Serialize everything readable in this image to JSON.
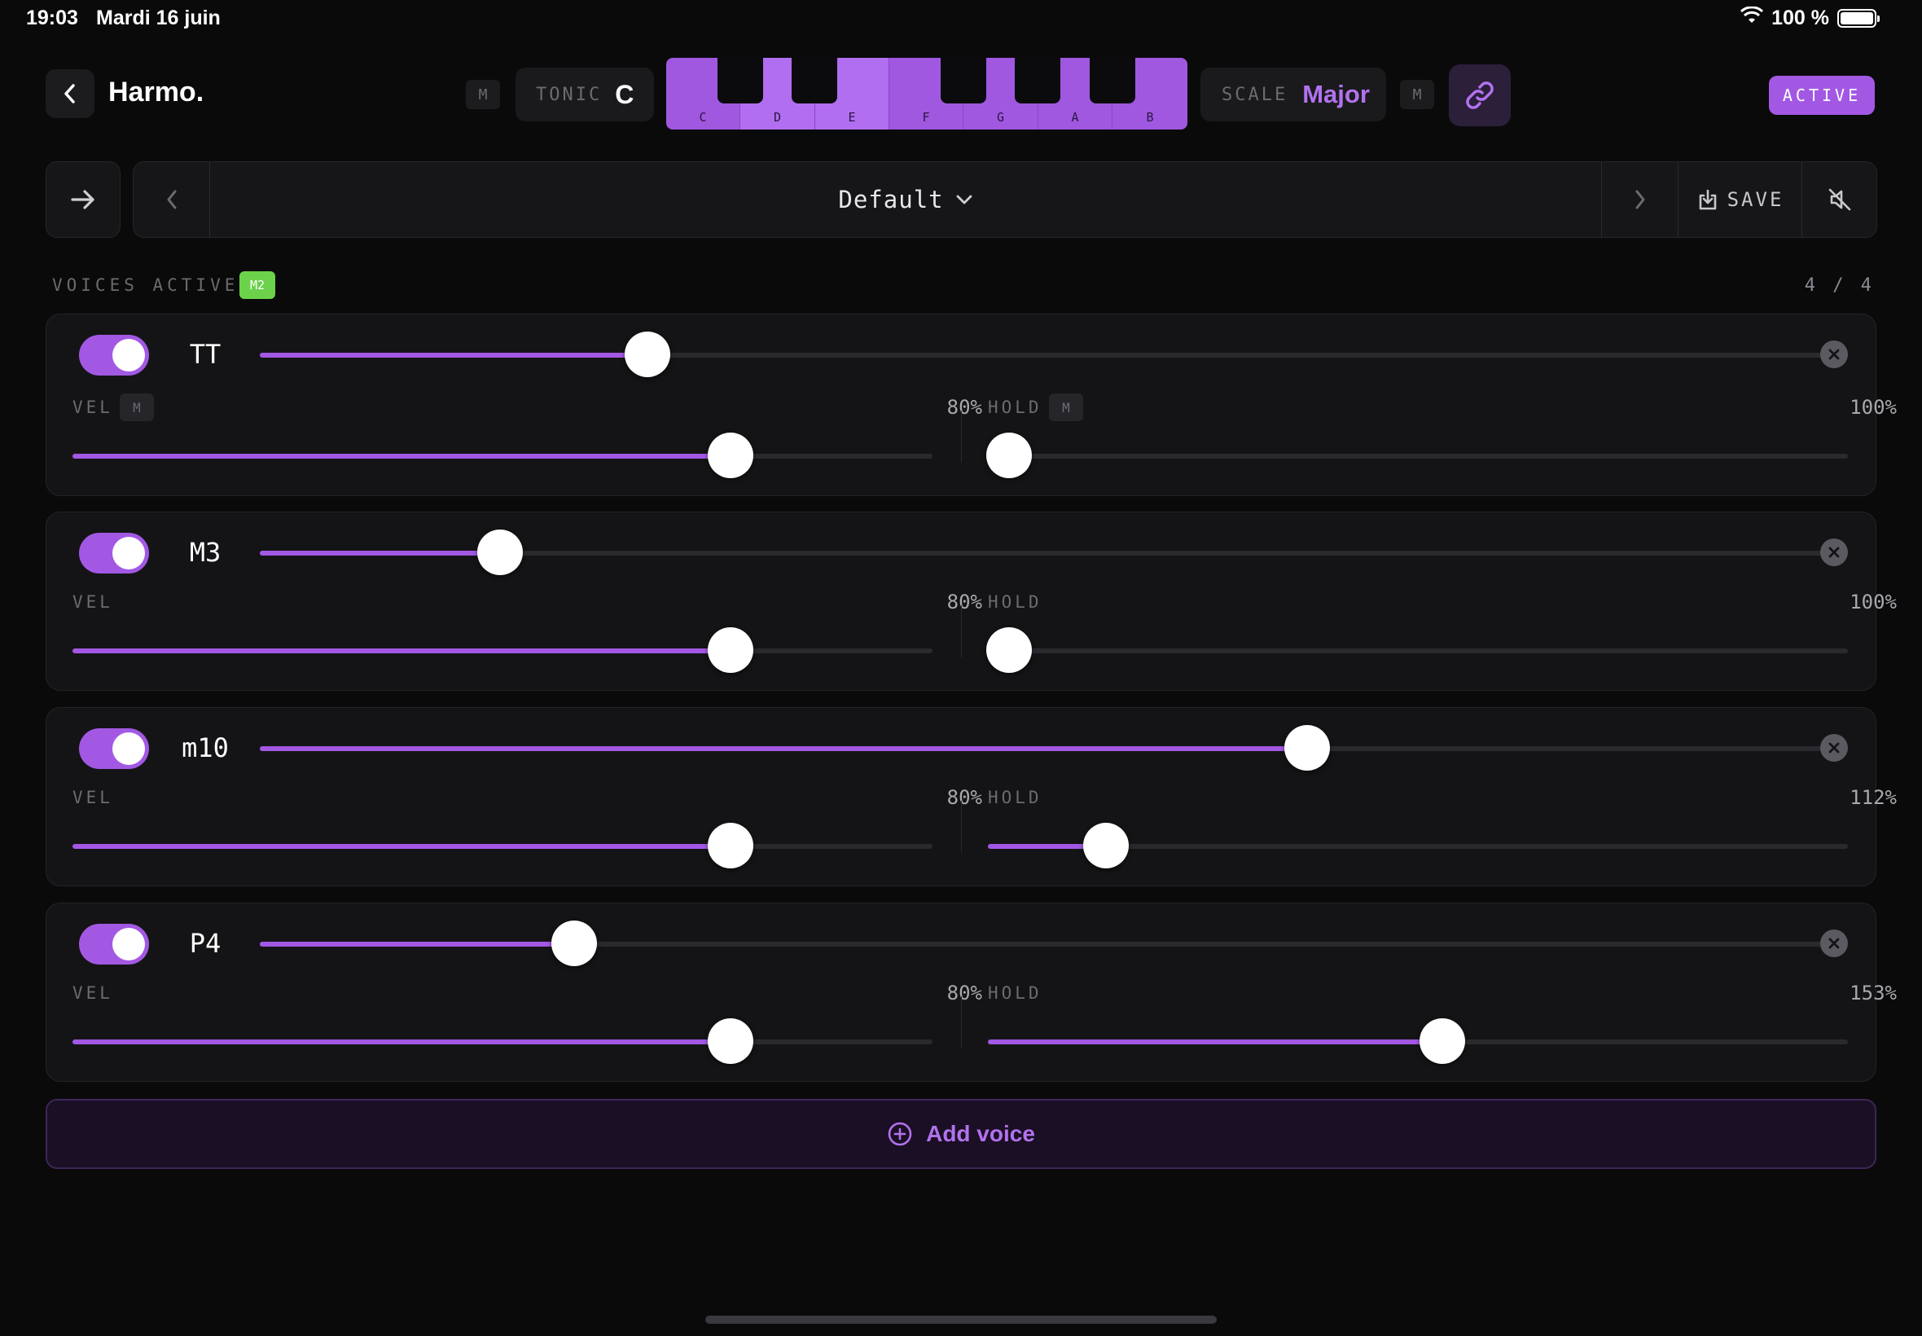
{
  "status_bar": {
    "time": "19:03",
    "date": "Mardi 16 juin",
    "battery": "100 %"
  },
  "header": {
    "title": "Harmo.",
    "m_left": "M",
    "tonic_label": "TONIC",
    "tonic_value": "C",
    "keyboard": {
      "white_keys": [
        "C",
        "D",
        "E",
        "F",
        "G",
        "A",
        "B"
      ],
      "active_keys": [
        "D",
        "E"
      ]
    },
    "scale_label": "SCALE",
    "scale_value": "Major",
    "m_right": "M",
    "status": "ACTIVE"
  },
  "preset": {
    "name": "Default",
    "save_label": "SAVE"
  },
  "voices_header": {
    "label": "VOICES ACTIVE",
    "badge": "M2",
    "count": "4 / 4"
  },
  "voices": [
    {
      "name": "TT",
      "enabled": true,
      "interval_level": 0.245,
      "vel_label": "VEL",
      "vel_m": "M",
      "vel_value": "80%",
      "vel_level": 0.765,
      "hold_label": "HOLD",
      "hold_m": "M",
      "hold_value": "100%",
      "hold_level": 0.025
    },
    {
      "name": "M3",
      "enabled": true,
      "interval_level": 0.152,
      "vel_label": "VEL",
      "vel_m": "",
      "vel_value": "80%",
      "vel_level": 0.765,
      "hold_label": "HOLD",
      "hold_m": "",
      "hold_value": "100%",
      "hold_level": 0.025
    },
    {
      "name": "m10",
      "enabled": true,
      "interval_level": 0.662,
      "vel_label": "VEL",
      "vel_m": "",
      "vel_value": "80%",
      "vel_level": 0.765,
      "hold_label": "HOLD",
      "hold_m": "",
      "hold_value": "112%",
      "hold_level": 0.137
    },
    {
      "name": "P4",
      "enabled": true,
      "interval_level": 0.199,
      "vel_label": "VEL",
      "vel_m": "",
      "vel_value": "80%",
      "vel_level": 0.765,
      "hold_label": "HOLD",
      "hold_m": "",
      "hold_value": "153%",
      "hold_level": 0.528
    }
  ],
  "add_voice_label": "Add voice",
  "colors": {
    "accent": "#a358e4",
    "badge_green": "#6cd24c",
    "background": "#0a0a0b"
  }
}
